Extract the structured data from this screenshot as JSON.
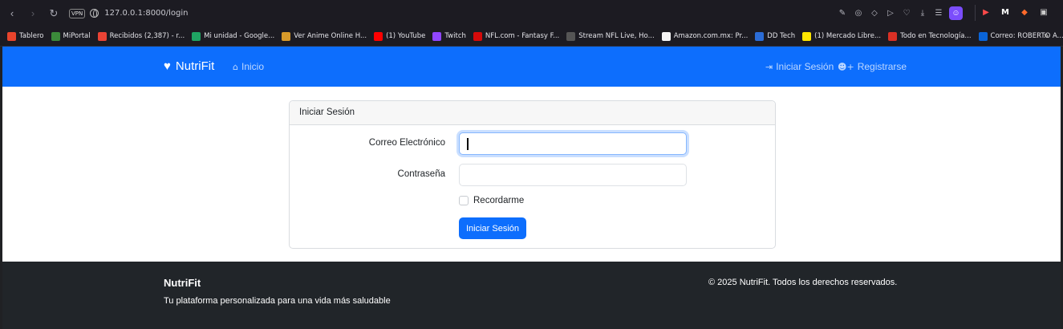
{
  "browser": {
    "vpn_label": "VPN",
    "url": "127.0.0.1:8000/login",
    "bookmarks": [
      {
        "label": "Tablero",
        "icon": "tablero-icon",
        "color": "#e8442c"
      },
      {
        "label": "MiPortal",
        "icon": "miportal-icon",
        "color": "#3b8a3a"
      },
      {
        "label": "Recibidos (2,387) - r...",
        "icon": "gmail-icon",
        "color": "#ea4335"
      },
      {
        "label": "Mi unidad - Google...",
        "icon": "drive-icon",
        "color": "#1fa463"
      },
      {
        "label": "Ver Anime Online H...",
        "icon": "anime-icon",
        "color": "#d89a2a"
      },
      {
        "label": "(1) YouTube",
        "icon": "youtube-icon",
        "color": "#ff0000"
      },
      {
        "label": "Twitch",
        "icon": "twitch-icon",
        "color": "#9146ff"
      },
      {
        "label": "NFL.com - Fantasy F...",
        "icon": "nfl-icon",
        "color": "#d50a0a"
      },
      {
        "label": "Stream NFL Live, Ho...",
        "icon": "stream-icon",
        "color": "#555555"
      },
      {
        "label": "Amazon.com.mx: Pr...",
        "icon": "amazon-icon",
        "color": "#f5f5f5"
      },
      {
        "label": "DD Tech",
        "icon": "ddtech-icon",
        "color": "#2b6cd6"
      },
      {
        "label": "(1) Mercado Libre...",
        "icon": "mercadolibre-icon",
        "color": "#ffe600"
      },
      {
        "label": "Todo en Tecnología...",
        "icon": "tecnologia-icon",
        "color": "#d93025"
      },
      {
        "label": "Correo: ROBERTO A...",
        "icon": "outlook-icon",
        "color": "#0a64d8"
      }
    ]
  },
  "navbar": {
    "brand": "NutriFit",
    "home": "Inicio",
    "login": "Iniciar Sesión",
    "register": "Registrarse"
  },
  "card": {
    "header": "Iniciar Sesión",
    "email_label": "Correo Electrónico",
    "email_value": "",
    "password_label": "Contraseña",
    "password_value": "",
    "remember_label": "Recordarme",
    "submit": "Iniciar Sesión"
  },
  "footer": {
    "title": "NutriFit",
    "tagline": "Tu plataforma personalizada para una vida más saludable",
    "copyright": "© 2025 NutriFit. Todos los derechos reservados."
  },
  "colors": {
    "primary": "#0d6efd",
    "footer_bg": "#212529",
    "focus_ring": "#86b7fe"
  }
}
